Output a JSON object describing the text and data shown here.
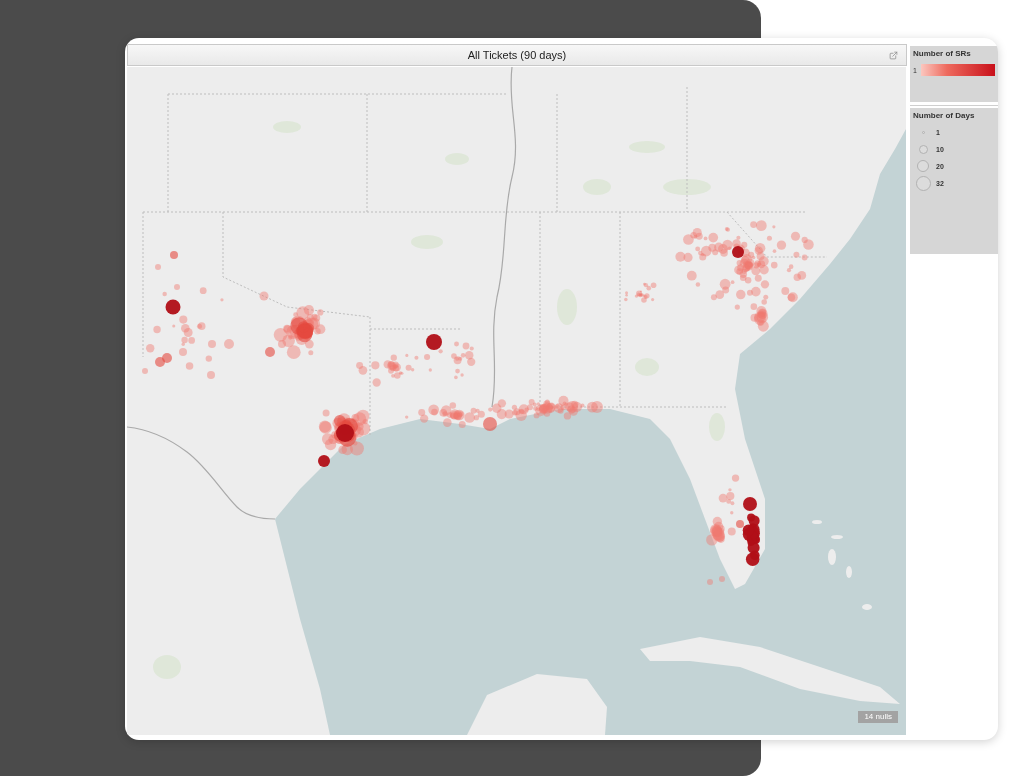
{
  "view": {
    "title": "All Tickets (90 days)"
  },
  "map": {
    "nulls_indicator": "14 nulls"
  },
  "color_legend": {
    "title": "Number of SRs",
    "min_label": "1"
  },
  "size_legend": {
    "title": "Number of Days",
    "items": [
      {
        "label": "1"
      },
      {
        "label": "10"
      },
      {
        "label": "20"
      },
      {
        "label": "32"
      }
    ]
  }
}
